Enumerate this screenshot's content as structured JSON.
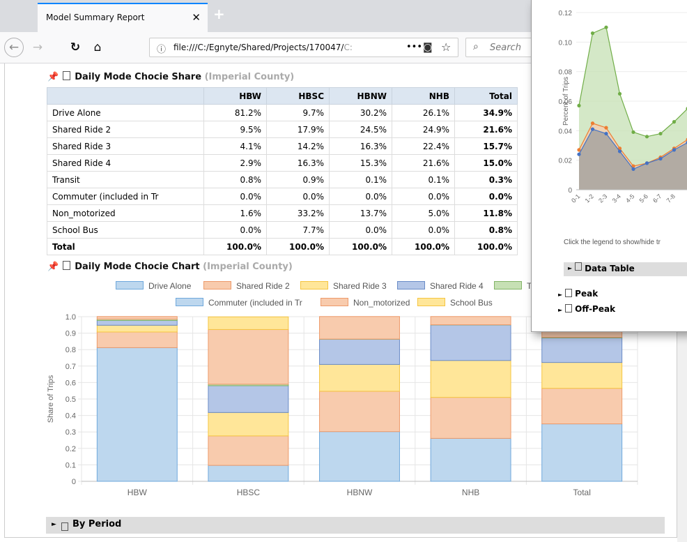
{
  "browser": {
    "tab_title": "Model Summary Report",
    "tab_close": "✕",
    "new_tab": "+",
    "url_prefix": "file:///C:/Egnyte/Shared/Projects/170047/",
    "url_tail": "C:",
    "url_menu": "•••",
    "search_placeholder": "Search"
  },
  "share_section": {
    "title": "Daily Mode Chocie Share",
    "subtitle": "(Imperial County)",
    "columns": [
      "",
      "HBW",
      "HBSC",
      "HBNW",
      "NHB",
      "Total"
    ],
    "rows": [
      [
        "Drive Alone",
        "81.2%",
        "9.7%",
        "30.2%",
        "26.1%",
        "34.9%"
      ],
      [
        "Shared Ride 2",
        "9.5%",
        "17.9%",
        "24.5%",
        "24.9%",
        "21.6%"
      ],
      [
        "Shared Ride 3",
        "4.1%",
        "14.2%",
        "16.3%",
        "22.4%",
        "15.7%"
      ],
      [
        "Shared Ride 4",
        "2.9%",
        "16.3%",
        "15.3%",
        "21.6%",
        "15.0%"
      ],
      [
        "Transit",
        "0.8%",
        "0.9%",
        "0.1%",
        "0.1%",
        "0.3%"
      ],
      [
        "Commuter (included in Tr",
        "0.0%",
        "0.0%",
        "0.0%",
        "0.0%",
        "0.0%"
      ],
      [
        "Non_motorized",
        "1.6%",
        "33.2%",
        "13.7%",
        "5.0%",
        "11.8%"
      ],
      [
        "School Bus",
        "0.0%",
        "7.7%",
        "0.0%",
        "0.0%",
        "0.8%"
      ],
      [
        "Total",
        "100.0%",
        "100.0%",
        "100.0%",
        "100.0%",
        "100.0%"
      ]
    ]
  },
  "chart_section": {
    "title": "Daily Mode Chocie Chart",
    "subtitle": "(Imperial County)"
  },
  "by_period_label": "By Period",
  "chart_data": [
    {
      "type": "bar",
      "stacked": true,
      "categories": [
        "HBW",
        "HBSC",
        "HBNW",
        "NHB",
        "Total"
      ],
      "ylabel": "Share of Trips",
      "ylim": [
        0,
        1.0
      ],
      "yticks": [
        "0",
        "0.1",
        "0.2",
        "0.3",
        "0.4",
        "0.5",
        "0.6",
        "0.7",
        "0.8",
        "0.9",
        "1.0"
      ],
      "series": [
        {
          "name": "Drive Alone",
          "values": [
            0.812,
            0.097,
            0.302,
            0.261,
            0.349
          ],
          "fill": "#bdd7ee",
          "stroke": "#6fa8dc"
        },
        {
          "name": "Shared Ride 2",
          "values": [
            0.095,
            0.179,
            0.245,
            0.249,
            0.216
          ],
          "fill": "#f8cbad",
          "stroke": "#ed9a6a"
        },
        {
          "name": "Shared Ride 3",
          "values": [
            0.041,
            0.142,
            0.163,
            0.224,
            0.157
          ],
          "fill": "#ffe699",
          "stroke": "#f5c542"
        },
        {
          "name": "Shared Ride 4",
          "values": [
            0.029,
            0.163,
            0.153,
            0.216,
            0.15
          ],
          "fill": "#b4c6e7",
          "stroke": "#6a8cc7"
        },
        {
          "name": "Transit",
          "values": [
            0.008,
            0.009,
            0.001,
            0.001,
            0.003
          ],
          "fill": "#c6e0b4",
          "stroke": "#82b366"
        },
        {
          "name": "Commuter (included in Tr",
          "values": [
            0.0,
            0.0,
            0.0,
            0.0,
            0.0
          ],
          "fill": "#bdd7ee",
          "stroke": "#6fa8dc"
        },
        {
          "name": "Non_motorized",
          "values": [
            0.016,
            0.332,
            0.137,
            0.05,
            0.118
          ],
          "fill": "#f8cbad",
          "stroke": "#ed9a6a"
        },
        {
          "name": "School Bus",
          "values": [
            0.0,
            0.077,
            0.0,
            0.0,
            0.008
          ],
          "fill": "#ffe699",
          "stroke": "#f5c542"
        }
      ]
    },
    {
      "type": "area",
      "ylabel": "Percent of Trips",
      "yticks": [
        "0",
        "0.02",
        "0.04",
        "0.06",
        "0.08",
        "0.10",
        "0.12"
      ],
      "ylim": [
        0,
        0.12
      ],
      "x_labels": [
        "0-1",
        "1-2",
        "2-3",
        "3-4",
        "4-5",
        "5-6",
        "6-7",
        "7-8"
      ],
      "series": [
        {
          "values": [
            0.057,
            0.106,
            0.11,
            0.065,
            0.039,
            0.036,
            0.038,
            0.046,
            0.055
          ],
          "fill": "#c6e0b4",
          "stroke": "#70ad47"
        },
        {
          "values": [
            0.027,
            0.045,
            0.042,
            0.028,
            0.016,
            0.018,
            0.022,
            0.028,
            0.034
          ],
          "fill": "#f8cbad",
          "stroke": "#ed7d31"
        },
        {
          "values": [
            0.024,
            0.041,
            0.038,
            0.026,
            0.014,
            0.018,
            0.021,
            0.027,
            0.032
          ],
          "fill": "#9e9e9e",
          "stroke": "#4472c4"
        }
      ]
    }
  ],
  "overlay": {
    "hint": "Click the legend to show/hide tr",
    "data_table": "Data Table",
    "peak": "Peak",
    "offpeak": "Off-Peak"
  }
}
